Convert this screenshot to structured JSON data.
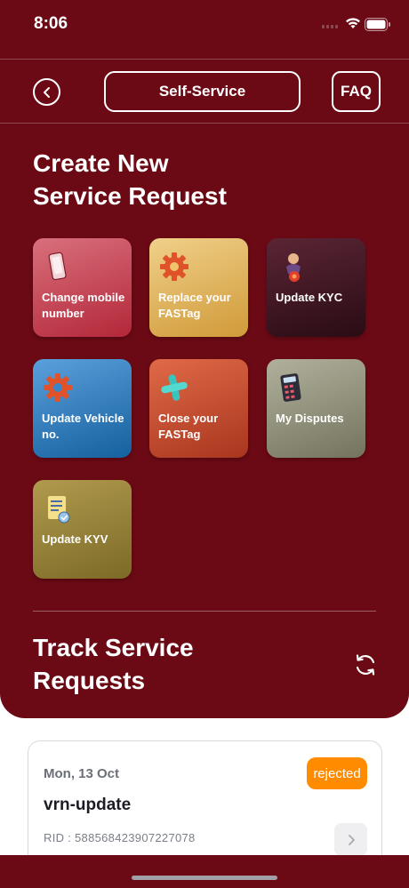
{
  "status_bar": {
    "time": "8:06"
  },
  "header": {
    "title": "Self-Service",
    "faq_label": "FAQ"
  },
  "create_section": {
    "title_line1": "Create New",
    "title_line2": "Service Request"
  },
  "tiles": [
    {
      "label": "Change mobile number",
      "icon": "mobile-phone-icon",
      "color": "#b8303f"
    },
    {
      "label": "Replace your FASTag",
      "icon": "gear-icon",
      "color": "#d9a84e"
    },
    {
      "label": "Update KYC",
      "icon": "person-icon",
      "color": "#3e1420"
    },
    {
      "label": "Update Vehicle no.",
      "icon": "gear-icon",
      "color": "#2a78b8"
    },
    {
      "label": "Close your FASTag",
      "icon": "plus-icon",
      "color": "#c04a2d"
    },
    {
      "label": "My Disputes",
      "icon": "calculator-icon",
      "color": "#8a8a78"
    },
    {
      "label": "Update KYV",
      "icon": "document-icon",
      "color": "#8f7a2c"
    }
  ],
  "track_section": {
    "title_line1": "Track Service",
    "title_line2": "Requests"
  },
  "requests": [
    {
      "date": "Mon, 13 Oct",
      "status": "rejected",
      "title": "vrn-update",
      "rid": "RID : 588568423907227078"
    }
  ],
  "colors": {
    "brand": "#6b0a15",
    "status_rejected": "#ff8c00"
  }
}
